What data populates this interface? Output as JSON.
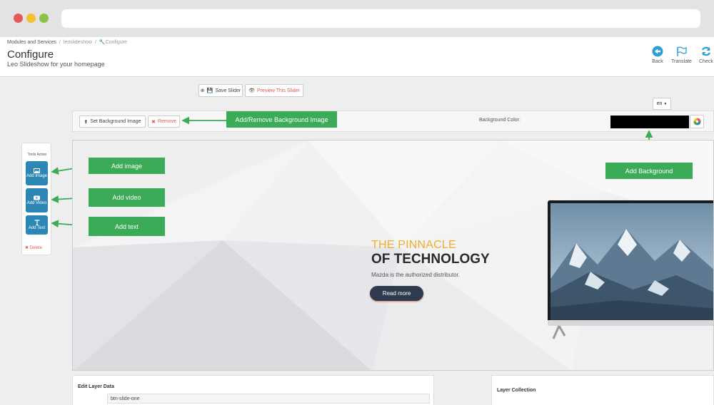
{
  "header": {
    "breadcrumb": [
      "Modules and Services",
      "leoslideshow",
      "Configure"
    ],
    "title": "Configure",
    "subtitle": "Leo Slideshow for your homepage",
    "actions": [
      {
        "label": "Back",
        "icon": "back-arrow-icon"
      },
      {
        "label": "Translate",
        "icon": "flag-icon"
      },
      {
        "label": "Check",
        "icon": "refresh-icon"
      }
    ]
  },
  "toolbar": {
    "save_label": "Save Slider",
    "preview_label": "Preview This Slider",
    "lang": "en"
  },
  "background_bar": {
    "set_label": "Set Background Image",
    "remove_label": "Remove",
    "color_label": "Background Color:",
    "color_value": "#000000"
  },
  "annotations": {
    "add_remove_bg": "Add/Remove Background Image",
    "add_image": "Add image",
    "add_video": "Add video",
    "add_text": "Add text",
    "add_background": "Add Background"
  },
  "tools": {
    "title": "Tools Action",
    "add_image": "Add Image",
    "add_video": "Add Video",
    "add_text": "Add Text",
    "delete": "Delete"
  },
  "slide": {
    "line1": "THE PINNACLE",
    "line2": "OF TECHNOLOGY",
    "tagline": "Mazda is the authorized distributor.",
    "button": "Read more"
  },
  "edit_layer": {
    "title": "Edit Layer Data",
    "value": "btn-slide-one"
  },
  "layer_collection": {
    "title": "Layer Collection"
  },
  "colors": {
    "accent_blue": "#2d87b4",
    "annotation_green": "#3bab57",
    "highlight_orange": "#f0ad2f",
    "danger_red": "#e35b4f"
  }
}
